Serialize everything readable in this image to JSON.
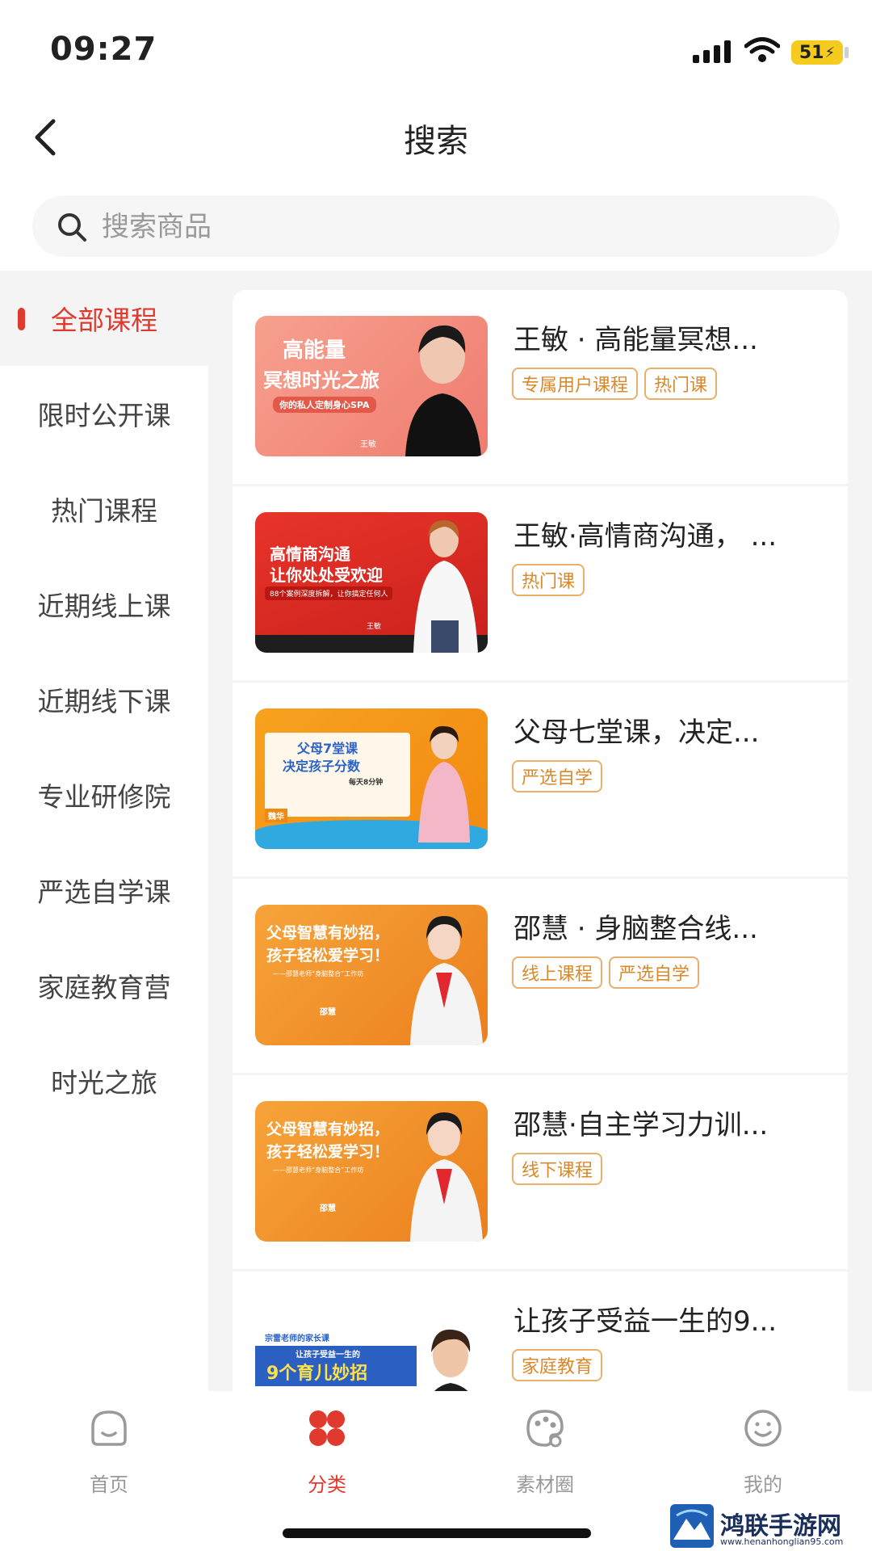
{
  "status_bar": {
    "time": "09:27",
    "battery": "51"
  },
  "nav": {
    "title": "搜索"
  },
  "search": {
    "placeholder": "搜索商品"
  },
  "categories": [
    {
      "label": "全部课程",
      "active": true
    },
    {
      "label": "限时公开课"
    },
    {
      "label": "热门课程"
    },
    {
      "label": "近期线上课"
    },
    {
      "label": "近期线下课"
    },
    {
      "label": "专业研修院"
    },
    {
      "label": "严选自学课"
    },
    {
      "label": "家庭教育营"
    },
    {
      "label": "时光之旅"
    }
  ],
  "courses": [
    {
      "title": "王敏 · 高能量冥想...",
      "tags": [
        "专属用户课程",
        "热门课"
      ],
      "thumb": {
        "lines": [
          "高能量",
          "冥想时光之旅",
          "你的私人定制身心SPA",
          "王敏"
        ]
      }
    },
    {
      "title": "王敏·高情商沟通， ...",
      "tags": [
        "热门课"
      ],
      "thumb": {
        "lines": [
          "高情商沟通",
          "让你处处受欢迎",
          "88个案例深度拆解，让你搞定任何人",
          "王敏"
        ]
      }
    },
    {
      "title": "父母七堂课，决定...",
      "tags": [
        "严选自学"
      ],
      "thumb": {
        "lines": [
          "父母7堂课",
          "决定孩子分数",
          "每天8分钟",
          "魏华"
        ]
      }
    },
    {
      "title": "邵慧 · 身脑整合线...",
      "tags": [
        "线上课程",
        "严选自学"
      ],
      "thumb": {
        "lines": [
          "父母智慧有妙招，",
          "孩子轻松爱学习！",
          "——邵慧老师“身脑整合”工作坊",
          "邵慧"
        ]
      }
    },
    {
      "title": "邵慧·自主学习力训...",
      "tags": [
        "线下课程"
      ],
      "thumb": {
        "lines": [
          "父母智慧有妙招，",
          "孩子轻松爱学习！",
          "——邵慧老师“身脑整合”工作坊",
          "邵慧"
        ]
      }
    },
    {
      "title": "让孩子受益一生的9...",
      "tags": [
        "家庭教育"
      ],
      "thumb": {
        "lines": [
          "让孩子受益一生的",
          "9个育儿妙招",
          "宗雷老师的家长课"
        ]
      }
    }
  ],
  "tabbar": {
    "items": [
      {
        "label": "首页",
        "icon": "home-icon"
      },
      {
        "label": "分类",
        "icon": "category-icon",
        "active": true
      },
      {
        "label": "素材圈",
        "icon": "palette-icon"
      },
      {
        "label": "我的",
        "icon": "profile-icon"
      }
    ]
  },
  "watermark": {
    "name": "鸿联手游网",
    "url": "www.henanhonglian95.com"
  },
  "colors": {
    "accent": "#e03a2f",
    "tag_border": "#e8b06a",
    "tag_text": "#d9892b"
  }
}
